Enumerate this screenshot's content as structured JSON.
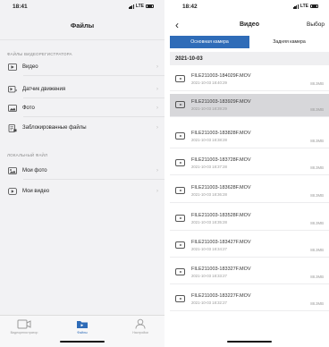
{
  "left": {
    "status": {
      "time": "18:41",
      "network": "LTE"
    },
    "title": "Файлы",
    "section1_label": "ФАЙЛЫ ВИДЕОРЕГИСТРАТОРА",
    "items1": [
      {
        "label": "Видео",
        "icon": "video-list-icon"
      },
      {
        "label": "Датчик движения",
        "icon": "motion-sensor-icon"
      },
      {
        "label": "Фото",
        "icon": "photo-icon"
      },
      {
        "label": "Заблокированные файлы",
        "icon": "locked-files-icon"
      }
    ],
    "section2_label": "ЛОКАЛЬНЫЙ ФАЙЛ",
    "items2": [
      {
        "label": "Мои фото",
        "icon": "my-photo-icon"
      },
      {
        "label": "Мои видео",
        "icon": "my-video-icon"
      }
    ],
    "tabs": [
      {
        "label": "Видеорегистратор",
        "icon": "dashcam-icon"
      },
      {
        "label": "Файлы",
        "icon": "folder-icon",
        "active": true
      },
      {
        "label": "Настройки",
        "icon": "profile-icon"
      }
    ],
    "active_color": "#2f6cb8"
  },
  "right": {
    "status": {
      "time": "18:42",
      "network": "LTE"
    },
    "title": "Видео",
    "select_label": "Выбор",
    "segments": [
      {
        "label": "Основная камера",
        "active": true
      },
      {
        "label": "Задняя камера",
        "active": false
      }
    ],
    "date_header": "2021-10-03",
    "files": [
      {
        "name": "FILE211003-184029F.MOV",
        "date": "2021-10-03 18:40:29",
        "size": "88.3MB",
        "selected": false
      },
      {
        "name": "FILE211003-183929F.MOV",
        "date": "2021-10-03 18:39:29",
        "size": "88.3MB",
        "selected": true
      },
      {
        "name": "FILE211003-183828F.MOV",
        "date": "2021-10-03 18:38:28",
        "size": "88.3MB",
        "selected": false
      },
      {
        "name": "FILE211003-183728F.MOV",
        "date": "2021-10-03 18:37:28",
        "size": "88.3MB",
        "selected": false
      },
      {
        "name": "FILE211003-183628F.MOV",
        "date": "2021-10-03 18:36:28",
        "size": "88.3MB",
        "selected": false
      },
      {
        "name": "FILE211003-183528F.MOV",
        "date": "2021-10-03 18:35:28",
        "size": "88.3MB",
        "selected": false
      },
      {
        "name": "FILE211003-183427F.MOV",
        "date": "2021-10-03 18:34:27",
        "size": "88.3MB",
        "selected": false
      },
      {
        "name": "FILE211003-183327F.MOV",
        "date": "2021-10-03 18:33:27",
        "size": "88.3MB",
        "selected": false
      },
      {
        "name": "FILE211003-183227F.MOV",
        "date": "2021-10-03 18:32:27",
        "size": "88.3MB",
        "selected": false
      }
    ],
    "accent_color": "#2f6cb8"
  }
}
